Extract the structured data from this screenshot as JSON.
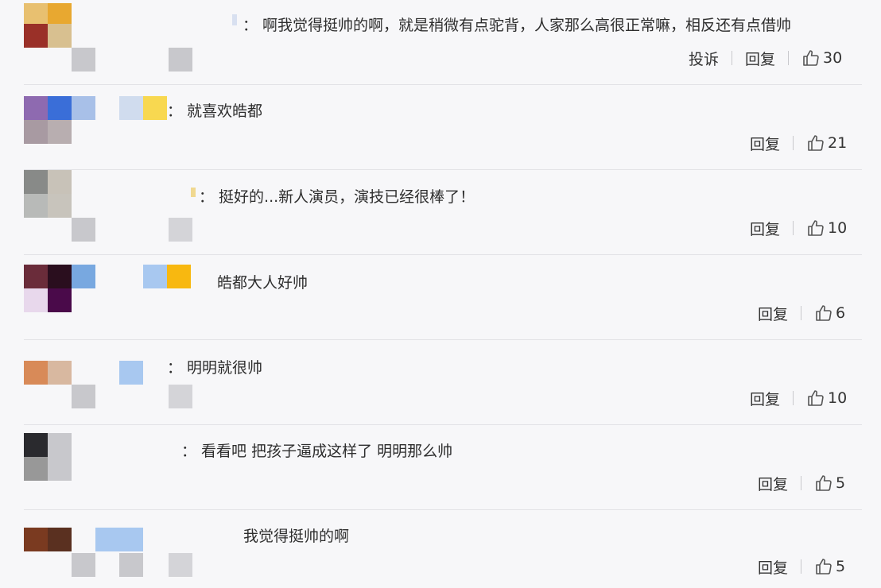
{
  "colors": {
    "background": "#f7f7f9",
    "divider": "#e2e2e6",
    "text": "#2e2e2e"
  },
  "icons": {
    "like": "thumbs-up-icon",
    "separator": "vertical-bar"
  },
  "comments": [
    {
      "text": "：  啊我觉得挺帅的啊，就是稍微有点驼背，人家那么高很正常嘛，相反还有点借帅",
      "report_label": "投诉",
      "reply_label": "回复",
      "likes": "30"
    },
    {
      "text": "：  就喜欢皓都",
      "reply_label": "回复",
      "likes": "21"
    },
    {
      "text": "：  挺好的...新人演员，演技已经很棒了！",
      "reply_label": "回复",
      "likes": "10"
    },
    {
      "text": "皓都大人好帅",
      "reply_label": "回复",
      "likes": "6"
    },
    {
      "text": "：  明明就很帅",
      "reply_label": "回复",
      "likes": "10"
    },
    {
      "text": "：  看看吧 把孩子逼成这样了 明明那么帅",
      "reply_label": "回复",
      "likes": "5"
    },
    {
      "text": "我觉得挺帅的啊",
      "reply_label": "回复",
      "likes": "5"
    }
  ]
}
